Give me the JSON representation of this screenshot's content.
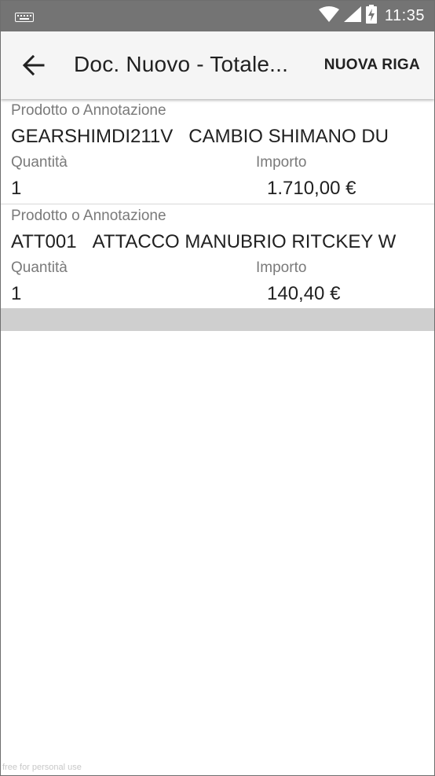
{
  "status_bar": {
    "time": "11:35",
    "icons": [
      "keyboard-icon",
      "wifi-icon",
      "signal-icon",
      "battery-charging-icon"
    ]
  },
  "app_bar": {
    "title": "Doc. Nuovo - Totale...",
    "action_label": "NUOVA RIGA",
    "back_icon": "arrow-back-icon"
  },
  "rows": [
    {
      "product_label": "Prodotto o Annotazione",
      "product_code": "GEARSHIMDI211V",
      "product_desc": "CAMBIO SHIMANO DU",
      "qty_label": "Quantità",
      "qty": "1",
      "amount_label": "Importo",
      "amount": "1.710,00 €"
    },
    {
      "product_label": "Prodotto o Annotazione",
      "product_code": "ATT001",
      "product_desc": "ATTACCO MANUBRIO RITCKEY W",
      "qty_label": "Quantità",
      "qty": "1",
      "amount_label": "Importo",
      "amount": "140,40 €"
    }
  ],
  "watermark": "free for personal use",
  "colors": {
    "status_bar": "#747474",
    "app_bar": "#f5f5f5",
    "footer_bar": "#cfcfcf",
    "label_text": "#7a7a7a",
    "value_text": "#212121"
  }
}
